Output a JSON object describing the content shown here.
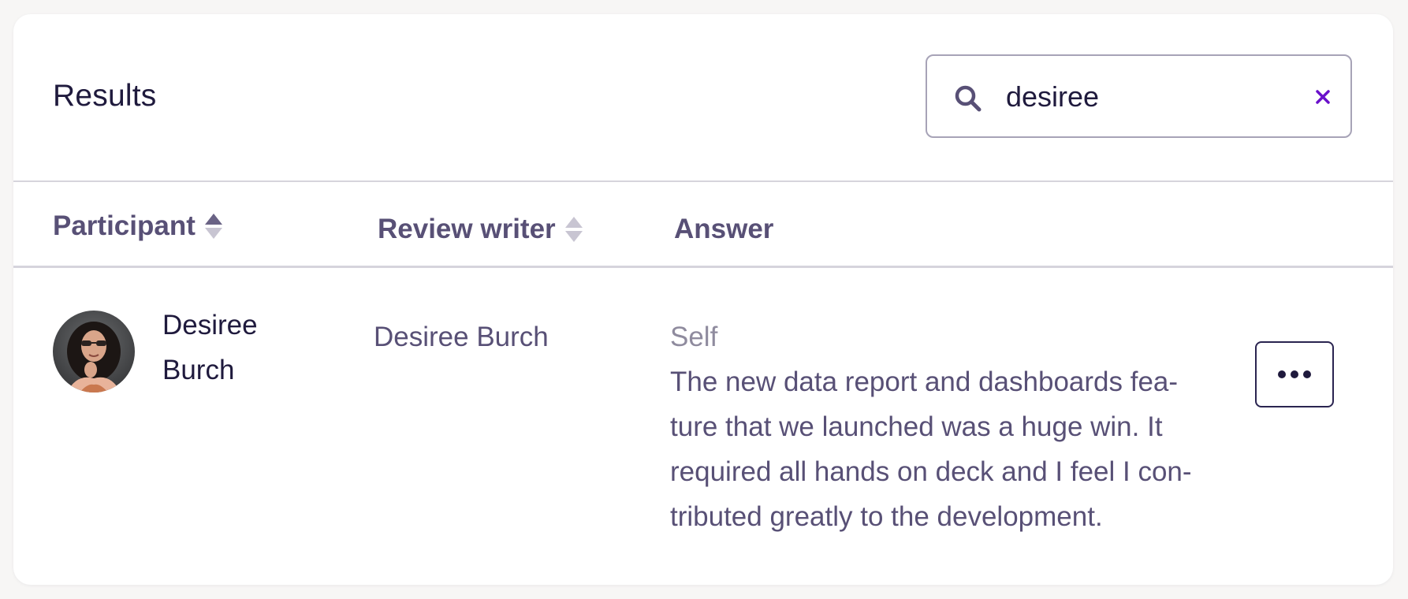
{
  "header": {
    "title": "Results"
  },
  "search": {
    "value": "desiree",
    "icon": "search-icon",
    "clear_icon": "close-icon"
  },
  "table": {
    "columns": [
      {
        "label": "Participant",
        "sortable": true,
        "sort_state": "ascending"
      },
      {
        "label": "Review writer",
        "sortable": true,
        "sort_state": "none"
      },
      {
        "label": "Answer",
        "sortable": false
      }
    ],
    "rows": [
      {
        "participant": {
          "name": "Desiree\nBurch",
          "avatar": "avatar-photo"
        },
        "review_writer": "Desiree Burch",
        "answer_type": "Self",
        "answer_text": "The new data report and dashboards fea-\nture that we launched was a huge win. It\nrequired all hands on deck and I feel I con-\ntributed greatly to the development.",
        "actions_icon": "more-horizontal-icon"
      }
    ]
  },
  "colors": {
    "heading": "#1f1a3d",
    "muted_text": "#585076",
    "accent": "#6a11cb",
    "divider": "#d6d4dc"
  }
}
